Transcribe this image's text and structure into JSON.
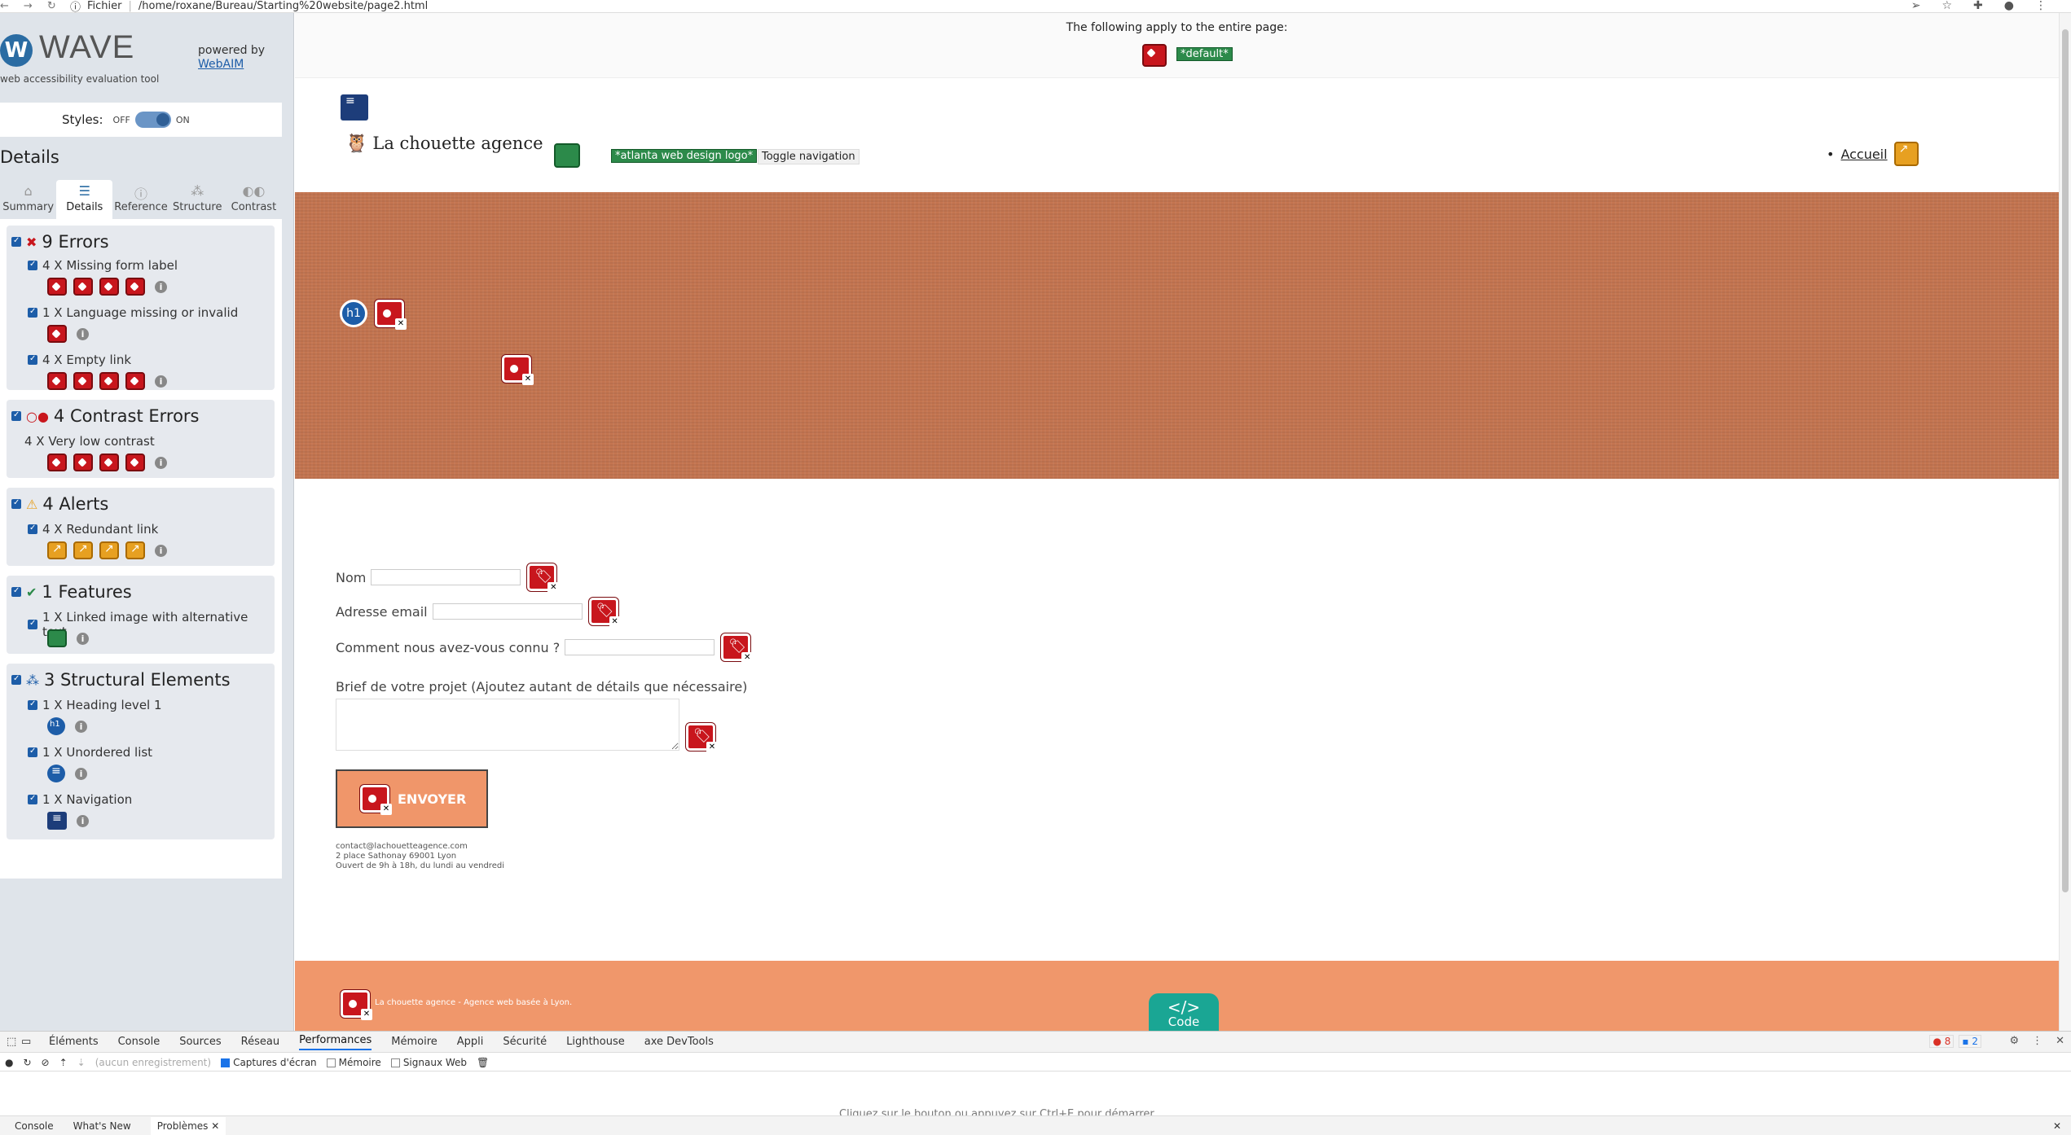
{
  "browser": {
    "scheme_label": "Fichier",
    "url": "/home/roxane/Bureau/Starting%20website/page2.html"
  },
  "wave": {
    "title": "WAVE",
    "subtitle": "web accessibility evaluation tool",
    "powered_by": "powered by",
    "powered_link": "WebAIM",
    "styles_label": "Styles:",
    "off": "OFF",
    "on": "ON",
    "details_heading": "Details",
    "tabs": [
      {
        "label": "Summary"
      },
      {
        "label": "Details"
      },
      {
        "label": "Reference"
      },
      {
        "label": "Structure"
      },
      {
        "label": "Contrast"
      }
    ],
    "sections": {
      "errors": {
        "title": "9 Errors",
        "items": [
          {
            "label": "4 X Missing form label",
            "count": 4
          },
          {
            "label": "1 X Language missing or invalid",
            "count": 1
          },
          {
            "label": "4 X Empty link",
            "count": 4
          }
        ]
      },
      "contrast": {
        "title": "4 Contrast Errors",
        "items": [
          {
            "label": "4 X Very low contrast",
            "count": 4
          }
        ]
      },
      "alerts": {
        "title": "4 Alerts",
        "items": [
          {
            "label": "4 X Redundant link",
            "count": 4
          }
        ]
      },
      "features": {
        "title": "1 Features",
        "items": [
          {
            "label": "1 X Linked image with alternative text",
            "count": 1
          }
        ]
      },
      "structure": {
        "title": "3 Structural Elements",
        "items": [
          {
            "label": "1 X Heading level 1",
            "count": 1
          },
          {
            "label": "1 X Unordered list",
            "count": 1
          },
          {
            "label": "1 X Navigation",
            "count": 1
          }
        ]
      }
    }
  },
  "page": {
    "top_note": "The following apply to the entire page:",
    "default_lang_tag": "*default*",
    "brand": "La chouette agence",
    "logo_alt_tag": "*atlanta web design logo*",
    "toggle_nav": "Toggle navigation",
    "nav_link": "Accueil",
    "form": {
      "nom": "Nom",
      "email": "Adresse email",
      "source": "Comment nous avez-vous connu ?",
      "brief": "Brief de votre projet (Ajoutez autant de détails que nécessaire)"
    },
    "send_label": "ENVOYER",
    "contact": {
      "email": "contact@lachouetteagence.com",
      "address": "2 place Sathonay 69001 Lyon",
      "hours": "Ouvert de 9h à 18h, du lundi au vendredi"
    },
    "footer_text": "La chouette agence - Agence web basée à Lyon.",
    "code_label": "Code",
    "code_icon": "</>"
  },
  "devtools": {
    "tabs": [
      {
        "label": "Éléments"
      },
      {
        "label": "Console"
      },
      {
        "label": "Sources"
      },
      {
        "label": "Réseau"
      },
      {
        "label": "Performances"
      },
      {
        "label": "Mémoire"
      },
      {
        "label": "Appli"
      },
      {
        "label": "Sécurité"
      },
      {
        "label": "Lighthouse"
      },
      {
        "label": "axe DevTools"
      }
    ],
    "recording": "(aucun enregistrement)",
    "screenshots": "Captures d'écran",
    "memory": "Mémoire",
    "web_vitals": "Signaux Web",
    "errors_badge": "8",
    "issues_badge": "2",
    "hint": "Cliquez sur le bouton  ou appuyez sur Ctrl+E pour démarrer",
    "bottom_tabs": [
      {
        "label": "Console"
      },
      {
        "label": "What's New"
      },
      {
        "label": "Problèmes"
      }
    ]
  },
  "colors": {
    "hero": "#c47550",
    "footer": "#f0976b",
    "error": "#c8161d",
    "alert": "#e7a021",
    "feature": "#2c8a4a",
    "structure": "#1d5da8"
  }
}
